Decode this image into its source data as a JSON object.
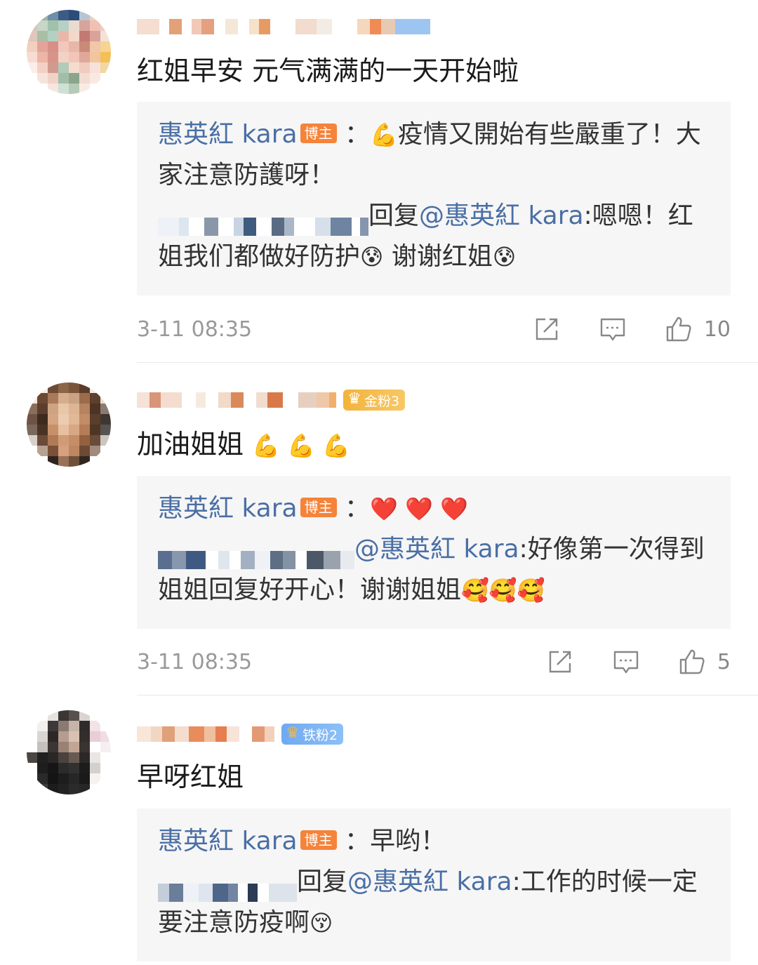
{
  "comments": [
    {
      "text": "红姐早安 元气满满的一天开始啦",
      "emoji": "",
      "fan_badge": "",
      "reply": {
        "blogger_name": "惠英紅 kara",
        "blogger_badge": "博主",
        "colon": "：",
        "blogger_emoji": "💪",
        "blogger_text": "疫情又開始有些嚴重了！大家注意防護呀！",
        "user_reply_prefix": "回复",
        "mention": "@惠英紅 kara",
        "user_reply_text": ":嗯嗯！红姐我们都做好防护",
        "user_emoji_1": "😰",
        "user_reply_text_2": " 谢谢红姐",
        "user_emoji_2": "😰"
      },
      "timestamp": "3-11 08:35",
      "likes": "10",
      "icons": [
        "share-icon",
        "comment-icon",
        "like-icon"
      ]
    },
    {
      "text": "加油姐姐",
      "emoji": "💪 💪 💪",
      "fan_badge": "金粉3",
      "reply": {
        "blogger_name": "惠英紅 kara",
        "blogger_badge": "博主",
        "colon": "：",
        "blogger_emoji": "❤️ ❤️ ❤️",
        "blogger_text": "",
        "mention": "@惠英紅 kara",
        "user_reply_text": ":好像第一次得到姐姐回复好开心！谢谢姐姐",
        "user_emoji_1": "🥰🥰🥰"
      },
      "timestamp": "3-11 08:35",
      "likes": "5"
    },
    {
      "text": "早呀红姐",
      "emoji": "",
      "fan_badge": "铁粉2",
      "reply": {
        "blogger_name": "惠英紅 kara",
        "blogger_badge": "博主",
        "colon": "：",
        "blogger_text": "早哟！",
        "user_reply_prefix": "回复",
        "mention": "@惠英紅 kara",
        "user_reply_text": ":工作的时候一定要注意防疫啊",
        "user_emoji_1": "😚"
      }
    }
  ],
  "colors": {
    "link_blue": "#4a6fa5",
    "blogger_badge": "#f5833a",
    "reply_bg": "#f6f6f6",
    "meta_gray": "#999999"
  }
}
